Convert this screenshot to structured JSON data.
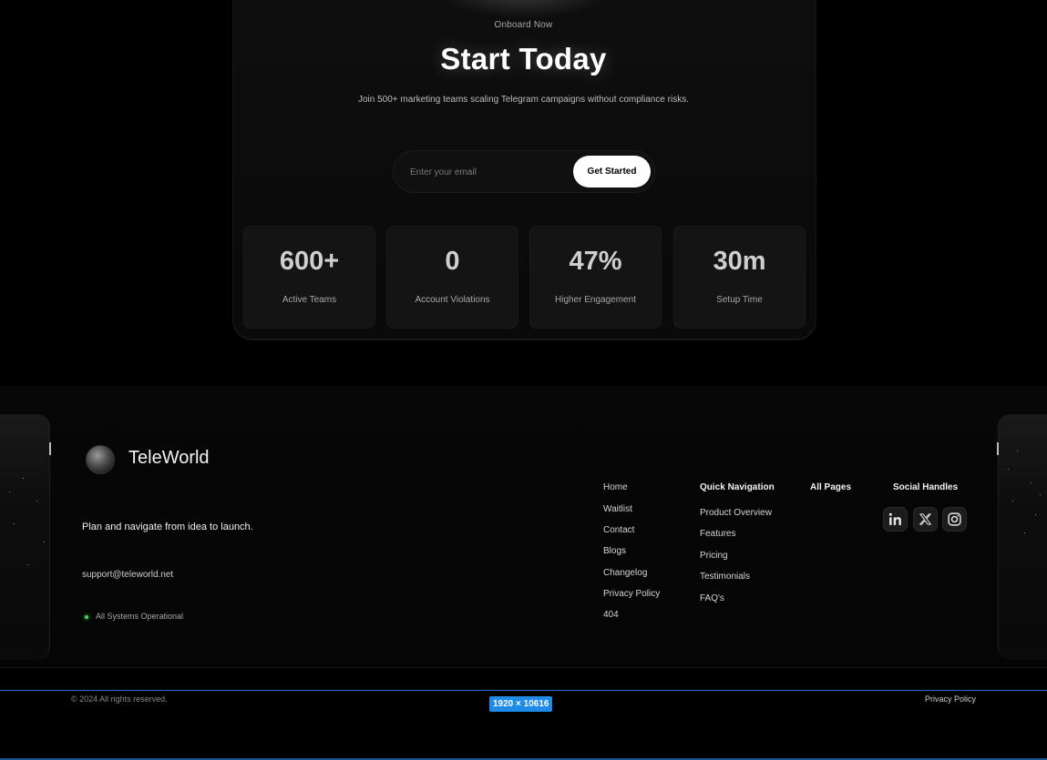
{
  "cta": {
    "eyebrow": "Onboard Now",
    "headline": "Start Today",
    "subline": "Join 500+ marketing teams scaling Telegram campaigns without compliance risks.",
    "email_placeholder": "Enter your email",
    "button_label": "Get Started"
  },
  "stats": [
    {
      "value": "600+",
      "label": "Active Teams"
    },
    {
      "value": "0",
      "label": "Account Violations"
    },
    {
      "value": "47%",
      "label": "Higher Engagement"
    },
    {
      "value": "30m",
      "label": "Setup Time"
    }
  ],
  "footer": {
    "brand": "TeleWorld",
    "tagline": "Plan and navigate from idea to launch.",
    "email": "support@teleworld.net",
    "status": "All Systems Operational",
    "status_color": "#3fd35c",
    "pages": [
      "Home",
      "Waitlist",
      "Contact",
      "Blogs",
      "Changelog",
      "Privacy Policy",
      "404"
    ],
    "quick_nav": {
      "heading": "Quick Navigation",
      "items": [
        "Product Overview",
        "Features",
        "Pricing",
        "Testimonials",
        "FAQ's"
      ]
    },
    "all_pages_heading": "All Pages",
    "social": {
      "heading": "Social Handles",
      "icons": [
        "linkedin-icon",
        "x-icon",
        "instagram-icon"
      ]
    }
  },
  "bottom": {
    "copyright": "© 2024 All rights reserved.",
    "dimensions": "1920 × 10616",
    "dimension_badge_color": "#1e8be8",
    "privacy": "Privacy Policy"
  }
}
